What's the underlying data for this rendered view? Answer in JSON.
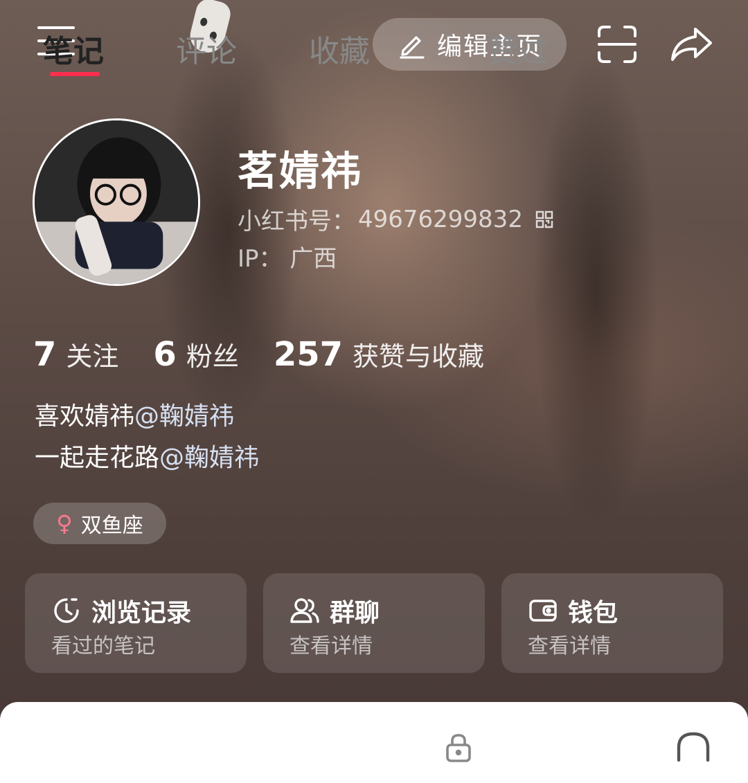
{
  "header": {
    "edit_label": "编辑主页"
  },
  "profile": {
    "name": "茗婧祎",
    "red_id_label": "小红书号：",
    "red_id": "49676299832",
    "ip_label": "IP：",
    "ip_value": "广西"
  },
  "stats": [
    {
      "value": "7",
      "label": "关注"
    },
    {
      "value": "6",
      "label": "粉丝"
    },
    {
      "value": "257",
      "label": "获赞与收藏"
    }
  ],
  "bio": {
    "line1_text": "喜欢婧祎",
    "line1_mention": "@鞠婧祎",
    "line2_text": "一起走花路",
    "line2_mention": "@鞠婧祎"
  },
  "tag": {
    "icon": "female-icon",
    "label": "双鱼座",
    "icon_color": "#ff7a8e"
  },
  "cards": [
    {
      "title": "浏览记录",
      "subtitle": "看过的笔记",
      "icon": "history-clock-icon"
    },
    {
      "title": "群聊",
      "subtitle": "查看详情",
      "icon": "group-chat-icon"
    },
    {
      "title": "钱包",
      "subtitle": "查看详情",
      "icon": "wallet-icon"
    }
  ],
  "tabs": [
    {
      "label": "笔记",
      "active": true
    },
    {
      "label": "评论",
      "active": false
    },
    {
      "label": "收藏",
      "active": false
    },
    {
      "label": "赞过",
      "active": false,
      "locked": true
    }
  ],
  "colors": {
    "accent": "#ff2e4d",
    "mention": "#d7e0f2"
  }
}
